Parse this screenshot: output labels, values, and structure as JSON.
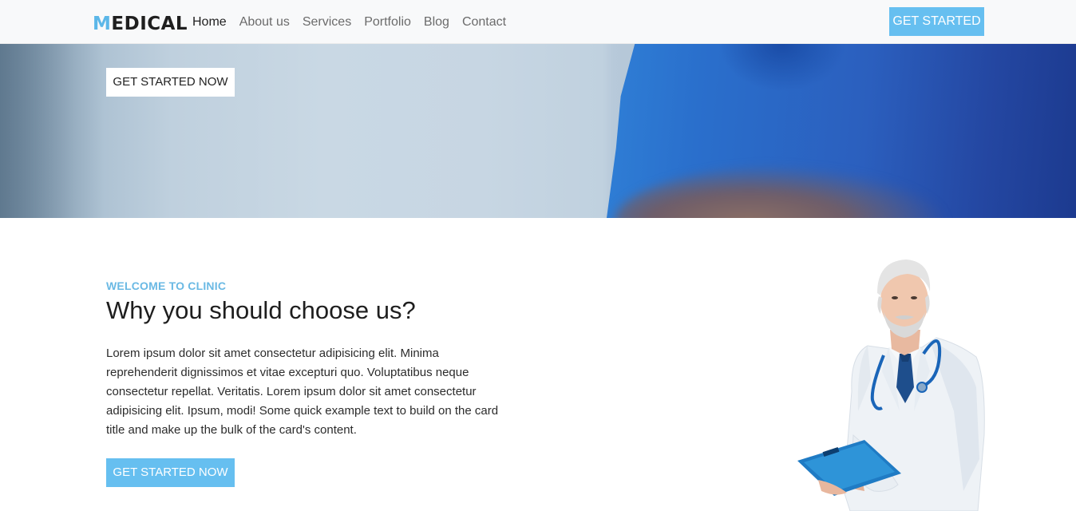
{
  "brand": {
    "accent_letter": "M",
    "rest": "EDICAL"
  },
  "nav": {
    "items": [
      "Home",
      "About us",
      "Services",
      "Portfolio",
      "Blog",
      "Contact"
    ],
    "cta_label": "GET STARTED"
  },
  "hero": {
    "button_label": "GET STARTED NOW"
  },
  "about": {
    "eyebrow": "WELCOME TO CLINIC",
    "heading": "Why you should choose us?",
    "body": "Lorem ipsum dolor sit amet consectetur adipisicing elit. Minima reprehenderit dignissimos et vitae excepturi quo. Voluptatibus neque consectetur repellat. Veritatis. Lorem ipsum dolor sit amet consectetur adipisicing elit. Ipsum, modi! Some quick example text to build on the card title and make up the bulk of the card's content.",
    "button_label": "GET STARTED NOW"
  },
  "colors": {
    "accent": "#66bff0",
    "brand_accent": "#5bb7e8",
    "nav_bg": "#f8f9fa",
    "scrub_blue": "#2a6fcc"
  }
}
